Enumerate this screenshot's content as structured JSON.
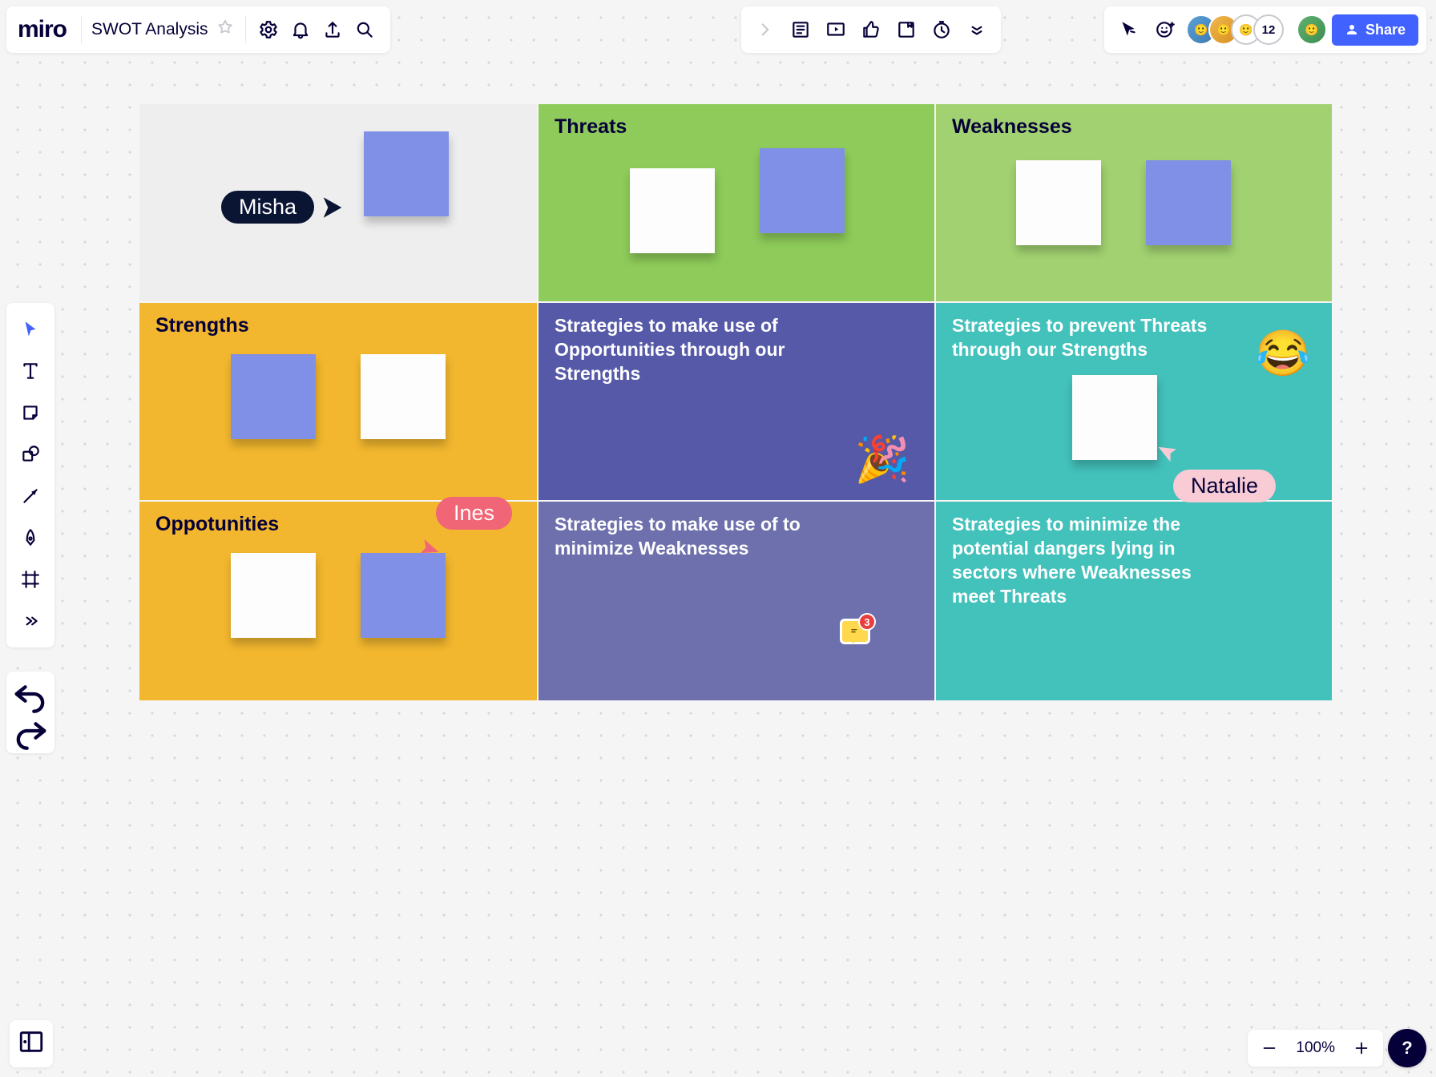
{
  "app": {
    "logo": "miro"
  },
  "board": {
    "title": "SWOT Analysis"
  },
  "topbar": {
    "share_label": "Share",
    "collaborator_count": "12"
  },
  "zoom": {
    "level": "100%"
  },
  "users": {
    "misha": "Misha",
    "ines": "Ines",
    "natalie": "Natalie"
  },
  "comments": {
    "count": "3"
  },
  "swot": {
    "threats": "Threats",
    "weaknesses": "Weaknesses",
    "strengths": "Strengths",
    "opportunities": "Oppotunities",
    "strat_SO": "Strategies to make use of Opportunities through our Strengths",
    "strat_ST": "Strategies to prevent Threats through our Strengths",
    "strat_WO": "Strategies to make use of to minimize Weaknesses",
    "strat_WT": "Strategies to minimize the potential dangers lying in sectors where Weaknesses meet Threats"
  },
  "colors": {
    "primary": "#4262ff",
    "dark": "#050038"
  }
}
